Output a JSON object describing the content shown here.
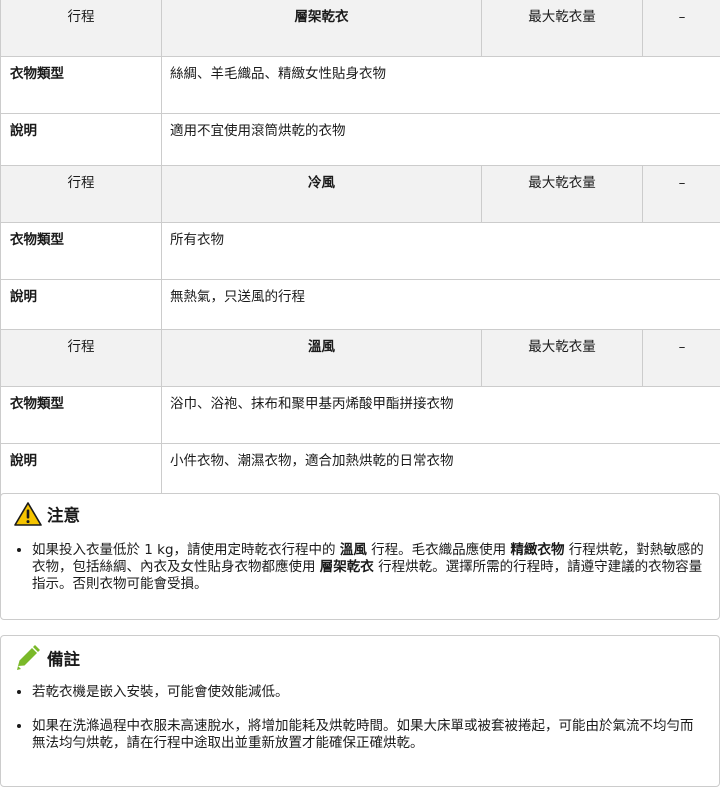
{
  "tables": [
    {
      "col1": "行程",
      "program": "層架乾衣",
      "col3": "最大乾衣量",
      "col4": "–",
      "type_label": "衣物類型",
      "type_value": "絲綢、羊毛織品、精緻女性貼身衣物",
      "desc_label": "說明",
      "desc_value": "適用不宜使用滾筒烘乾的衣物"
    },
    {
      "col1": "行程",
      "program": "冷風",
      "col3": "最大乾衣量",
      "col4": "–",
      "type_label": "衣物類型",
      "type_value": "所有衣物",
      "desc_label": "說明",
      "desc_value": "無熱氣，只送風的行程"
    },
    {
      "col1": "行程",
      "program": "溫風",
      "col3": "最大乾衣量",
      "col4": "–",
      "type_label": "衣物類型",
      "type_value": "浴巾、浴袍、抹布和聚甲基丙烯酸甲酯拼接衣物",
      "desc_label": "說明",
      "desc_value": "小件衣物、潮濕衣物，適合加熱烘乾的日常衣物"
    }
  ],
  "caution": {
    "title": "注意",
    "icon": "warning-triangle-icon",
    "item": {
      "p1": "如果投入衣量低於 1 kg，請使用定時乾衣行程中的 ",
      "b1": "溫風",
      "p2": " 行程。毛衣織品應使用 ",
      "b2": "精緻衣物",
      "p3": " 行程烘乾，對熱敏感的衣物，包括絲綢、內衣及女性貼身衣物都應使用 ",
      "b3": "層架乾衣",
      "p4": " 行程烘乾。選擇所需的行程時，請遵守建議的衣物容量指示。否則衣物可能會受損。"
    }
  },
  "remark": {
    "title": "備註",
    "icon": "pencil-icon",
    "items": [
      "若乾衣機是嵌入安裝，可能會使效能減低。",
      "如果在洗滌過程中衣服未高速脫水，將增加能耗及烘乾時間。如果大床單或被套被捲起，可能由於氣流不均勻而無法均勻烘乾，請在行程中途取出並重新放置才能確保正確烘乾。"
    ]
  },
  "colors": {
    "border": "#cccccc",
    "header_bg": "#f2f2f2",
    "warning": "#f5c400",
    "pencil": "#7ab929"
  }
}
